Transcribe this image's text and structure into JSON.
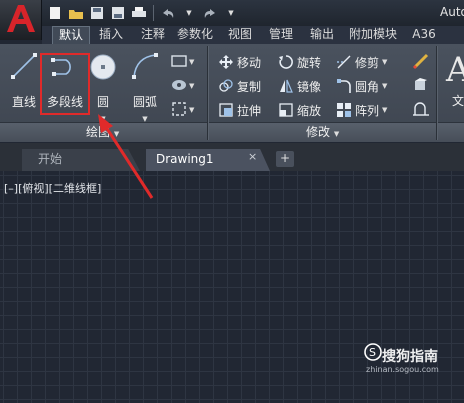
{
  "title": {
    "text": "Auto"
  },
  "quick_access": {
    "items": [
      "new-icon",
      "open-icon",
      "save-icon",
      "saveas-icon",
      "print-icon",
      "undo-icon",
      "redo-icon"
    ]
  },
  "ribbon_tabs": [
    "默认",
    "插入",
    "注释",
    "参数化",
    "视图",
    "管理",
    "输出",
    "附加模块",
    "A36"
  ],
  "active_tab": "默认",
  "draw_panel": {
    "title": "绘图",
    "buttons": {
      "line": "直线",
      "polyline": "多段线",
      "circle": "圆",
      "arc": "圆弧"
    }
  },
  "modify_panel": {
    "title": "修改",
    "items": {
      "move": "移动",
      "rotate": "旋转",
      "trim": "修剪",
      "copy": "复制",
      "mirror": "镜像",
      "fillet": "圆角",
      "stretch": "拉伸",
      "scale": "缩放",
      "array": "阵列"
    }
  },
  "right_cutoff": "文",
  "doc_tabs": {
    "start": "开始",
    "drawing": "Drawing1",
    "close": "×",
    "plus": "+"
  },
  "viewport_label": "[–][俯视][二维线框]",
  "watermark": {
    "brand": "搜狗指南",
    "url": "zhinan.sogou.com"
  },
  "colors": {
    "highlight": "#e02a2a",
    "annotation_arrow": "#e02a2a",
    "canvas": "#212733"
  }
}
